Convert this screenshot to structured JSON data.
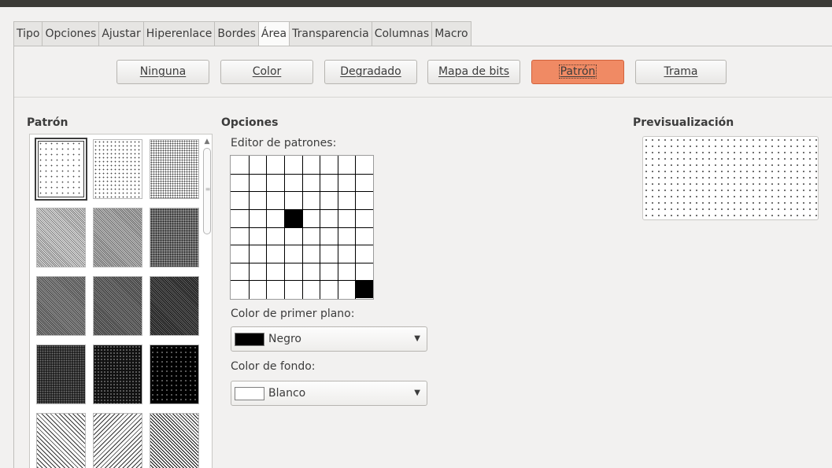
{
  "tabs": [
    {
      "label": "Tipo",
      "active": false
    },
    {
      "label": "Opciones",
      "active": false
    },
    {
      "label": "Ajustar",
      "active": false
    },
    {
      "label": "Hiperenlace",
      "active": false
    },
    {
      "label": "Bordes",
      "active": false
    },
    {
      "label": "Área",
      "active": true
    },
    {
      "label": "Transparencia",
      "active": false
    },
    {
      "label": "Columnas",
      "active": false
    },
    {
      "label": "Macro",
      "active": false
    }
  ],
  "fill_buttons": [
    {
      "label": "Ninguna",
      "active": false
    },
    {
      "label": "Color",
      "active": false
    },
    {
      "label": "Degradado",
      "active": false
    },
    {
      "label": "Mapa de bits",
      "active": false
    },
    {
      "label": "Patrón",
      "active": true
    },
    {
      "label": "Trama",
      "active": false
    }
  ],
  "pattern_section": {
    "heading": "Patrón",
    "selected_index": 0
  },
  "options_section": {
    "heading": "Opciones",
    "editor_label": "Editor de patrones:",
    "editor_cells_on": [
      [
        3,
        3
      ],
      [
        7,
        7
      ]
    ],
    "foreground_label": "Color de primer plano:",
    "foreground_value": "Negro",
    "foreground_color": "#000000",
    "background_label": "Color de fondo:",
    "background_value": "Blanco",
    "background_color": "#ffffff"
  },
  "preview_section": {
    "heading": "Previsualización"
  }
}
